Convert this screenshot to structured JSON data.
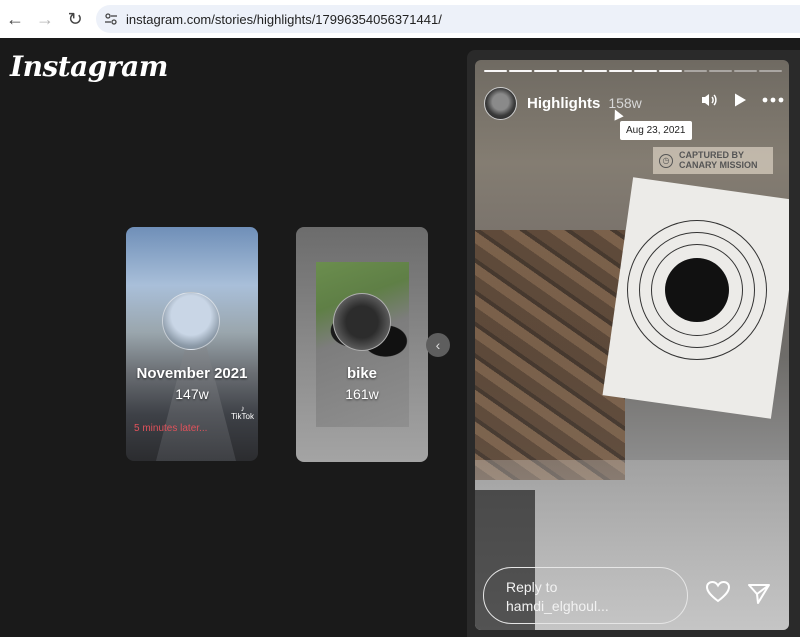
{
  "browser": {
    "back_icon": "arrow-left-icon",
    "forward_icon": "arrow-right-icon",
    "reload_icon": "reload-icon",
    "url": "instagram.com/stories/highlights/17996354056371441/"
  },
  "app": {
    "logo": "Instagram"
  },
  "highlights": [
    {
      "title": "November 2021",
      "age": "147w",
      "overlay_text": "5 minutes later...",
      "badge": "TikTok"
    },
    {
      "title": "bike",
      "age": "161w"
    }
  ],
  "story": {
    "title": "Highlights",
    "age": "158w",
    "tooltip": "Aug 23, 2021",
    "stamp_line1": "CAPTURED BY",
    "stamp_line2": "CANARY MISSION",
    "reply_line1": "Reply to",
    "reply_line2": "hamdi_elghoul...",
    "progress_total": 12,
    "progress_done": 8,
    "icons": [
      "volume-icon",
      "play-icon",
      "more-icon"
    ]
  },
  "colors": {
    "background": "#1a1a1a",
    "overlay_red": "#e0525b"
  }
}
